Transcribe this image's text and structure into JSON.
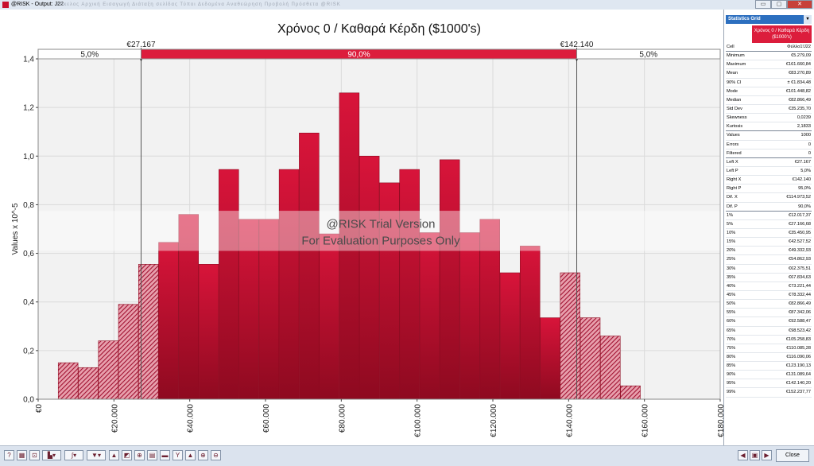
{
  "window": {
    "title": "@RISK - Output: J22",
    "menu_ghost": "Φάκελος   Αρχική   Εισαγωγή   Διάταξη σελίδας   Τύποι   Δεδομένα   Αναθεώρηση   Προβολή   Πρόσθετα   @RISK",
    "min_glyph": "▭",
    "max_glyph": "▢",
    "close_glyph": "✕"
  },
  "chart_data": {
    "type": "bar",
    "title": "Χρόνος 0 / Καθαρά Κέρδη ($1000's)",
    "xlabel": "",
    "ylabel": "Values x 10^-5",
    "xlim": [
      0,
      180000
    ],
    "ylim": [
      0,
      1.4
    ],
    "bin_width": 5300,
    "bin_start": 5300,
    "values": [
      0.15,
      0.13,
      0.24,
      0.39,
      0.555,
      0.645,
      0.76,
      0.555,
      0.945,
      0.74,
      0.74,
      0.945,
      1.095,
      0.68,
      1.26,
      1.0,
      0.89,
      0.945,
      0.685,
      0.985,
      0.685,
      0.74,
      0.52,
      0.63,
      0.335,
      0.52,
      0.335,
      0.26,
      0.055
    ],
    "y_ticks": [
      {
        "v": 0.0,
        "label": "0,0"
      },
      {
        "v": 0.2,
        "label": "0,2"
      },
      {
        "v": 0.4,
        "label": "0,4"
      },
      {
        "v": 0.6,
        "label": "0,6"
      },
      {
        "v": 0.8,
        "label": "0,8"
      },
      {
        "v": 1.0,
        "label": "1,0"
      },
      {
        "v": 1.2,
        "label": "1,2"
      },
      {
        "v": 1.4,
        "label": "1,4"
      }
    ],
    "x_ticks": [
      {
        "v": 0,
        "label": "€0"
      },
      {
        "v": 20000,
        "label": "€20.000"
      },
      {
        "v": 40000,
        "label": "€40.000"
      },
      {
        "v": 60000,
        "label": "€60.000"
      },
      {
        "v": 80000,
        "label": "€80.000"
      },
      {
        "v": 100000,
        "label": "€100.000"
      },
      {
        "v": 120000,
        "label": "€120.000"
      },
      {
        "v": 140000,
        "label": "€140.000"
      },
      {
        "v": 160000,
        "label": "€160.000"
      },
      {
        "v": 180000,
        "label": "€180.000"
      }
    ],
    "left_delimiter": {
      "x": 27167,
      "label": "€27.167"
    },
    "right_delimiter": {
      "x": 142140,
      "label": "€142.140"
    },
    "band_labels": {
      "left": "5,0%",
      "middle": "90,0%",
      "right": "5,0%"
    },
    "watermark": [
      "@RISK Trial Version",
      "For Evaluation Purposes Only"
    ],
    "colors": {
      "bar": "#c8102e",
      "bar_dark": "#8e0a20",
      "band": "#dc1d3c",
      "plot_bg": "#f2f2f2",
      "grid": "#ffffff"
    }
  },
  "stats": {
    "header": "Statistics Grid",
    "dropdown_glyph": "▾",
    "column_head": "Χρόνος 0 / Καθαρά Κέρδη ($1000's)",
    "rows": [
      {
        "label": "Cell",
        "value": "Φύλλο1!J22",
        "sep": true
      },
      {
        "label": "Minimum",
        "value": "€5.279,09"
      },
      {
        "label": "Maximum",
        "value": "€161.660,84"
      },
      {
        "label": "Mean",
        "value": "€83.270,89"
      },
      {
        "label": "90% CI",
        "value": "± €1.834,48"
      },
      {
        "label": "Mode",
        "value": "€101.448,82"
      },
      {
        "label": "Median",
        "value": "€82.866,49"
      },
      {
        "label": "Std Dev",
        "value": "€35.235,70"
      },
      {
        "label": "Skewness",
        "value": "0,0239"
      },
      {
        "label": "Kurtosis",
        "value": "2,1833",
        "sep": true
      },
      {
        "label": "Values",
        "value": "1000"
      },
      {
        "label": "Errors",
        "value": "0"
      },
      {
        "label": "Filtered",
        "value": "0",
        "sep": true
      },
      {
        "label": "Left X",
        "value": "€27.167"
      },
      {
        "label": "Left P",
        "value": "5,0%"
      },
      {
        "label": "Right X",
        "value": "€142.140"
      },
      {
        "label": "Right P",
        "value": "95,0%"
      },
      {
        "label": "Dif. X",
        "value": "€114.973,52"
      },
      {
        "label": "Dif. P",
        "value": "90,0%",
        "sep": true
      },
      {
        "label": "1%",
        "value": "€12.017,37"
      },
      {
        "label": "5%",
        "value": "€27.166,68"
      },
      {
        "label": "10%",
        "value": "€35.450,95"
      },
      {
        "label": "15%",
        "value": "€42.527,52"
      },
      {
        "label": "20%",
        "value": "€49.332,93"
      },
      {
        "label": "25%",
        "value": "€54.862,93"
      },
      {
        "label": "30%",
        "value": "€62.375,51"
      },
      {
        "label": "35%",
        "value": "€67.834,63"
      },
      {
        "label": "40%",
        "value": "€73.221,44"
      },
      {
        "label": "45%",
        "value": "€78.332,44"
      },
      {
        "label": "50%",
        "value": "€82.866,49"
      },
      {
        "label": "55%",
        "value": "€87.342,06"
      },
      {
        "label": "60%",
        "value": "€92.588,47"
      },
      {
        "label": "65%",
        "value": "€98.523,42"
      },
      {
        "label": "70%",
        "value": "€105.258,83"
      },
      {
        "label": "75%",
        "value": "€110.085,28"
      },
      {
        "label": "80%",
        "value": "€116.090,06"
      },
      {
        "label": "85%",
        "value": "€123.190,13"
      },
      {
        "label": "90%",
        "value": "€131.089,64"
      },
      {
        "label": "95%",
        "value": "€142.140,20"
      },
      {
        "label": "99%",
        "value": "€152.237,77"
      }
    ]
  },
  "toolbar": {
    "close_label": "Close",
    "buttons": [
      {
        "name": "help-icon",
        "glyph": "?"
      },
      {
        "name": "stats-table-icon",
        "glyph": "▦"
      },
      {
        "name": "zoom-reset-icon",
        "glyph": "⊡"
      },
      {
        "name": "histogram-dropdown-icon",
        "glyph": "▙▾"
      },
      {
        "name": "curve-dropdown-icon",
        "glyph": "∫▾"
      },
      {
        "name": "filter-dropdown-icon",
        "glyph": "▼▾"
      },
      {
        "name": "distribution-fit-icon",
        "glyph": "▲"
      },
      {
        "name": "overlay-icon",
        "glyph": "◩"
      },
      {
        "name": "add-overlay-icon",
        "glyph": "⊕"
      },
      {
        "name": "scenario-icon",
        "glyph": "▤"
      },
      {
        "name": "tornado-icon",
        "glyph": "▬"
      },
      {
        "name": "snap-icon",
        "glyph": "Y"
      },
      {
        "name": "shape-icon",
        "glyph": "▲"
      },
      {
        "name": "zoom-in-icon",
        "glyph": "⊕"
      },
      {
        "name": "zoom-out-icon",
        "glyph": "⊖"
      }
    ],
    "nav": [
      {
        "name": "prev-icon",
        "glyph": "◀"
      },
      {
        "name": "window-icon",
        "glyph": "▣"
      },
      {
        "name": "next-icon",
        "glyph": "▶"
      }
    ]
  }
}
